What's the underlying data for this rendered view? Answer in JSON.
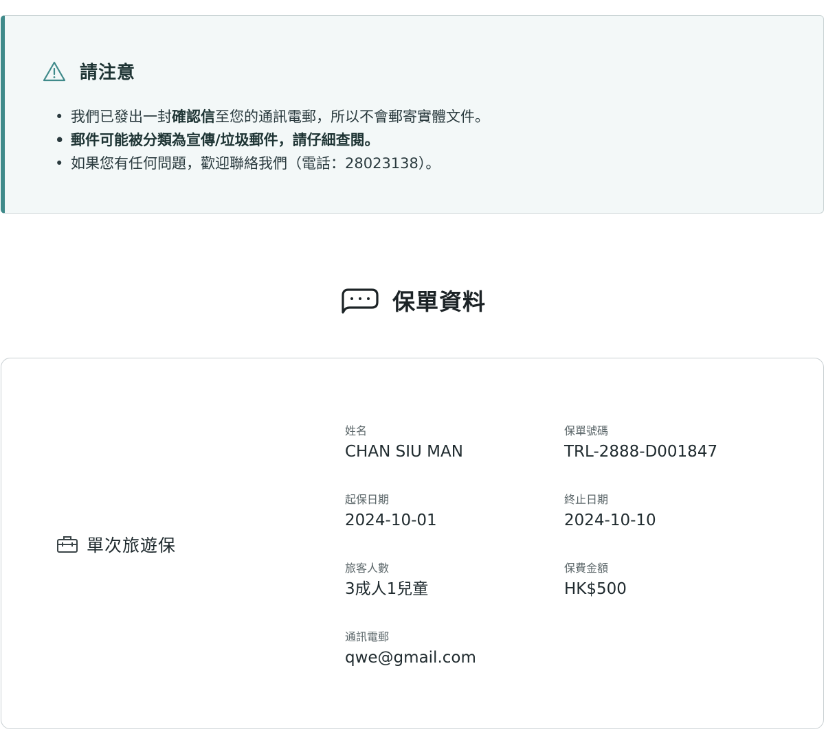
{
  "notice": {
    "title": "請注意",
    "icon": "warning-icon",
    "accent_color": "#3f8a8a",
    "line1_pre": "我們已發出一封",
    "line1_strong": "確認信",
    "line1_post": "至您的通訊電郵，所以不會郵寄實體文件。",
    "line2": "郵件可能被分類為宣傳/垃圾郵件，請仔細查閱。",
    "line3": "如果您有任何問題，歡迎聯絡我們（電話：28023138）。"
  },
  "section": {
    "title": "保單資料",
    "icon": "chat-bubble-icon"
  },
  "policy": {
    "plan_icon": "briefcase-icon",
    "plan_name": "單次旅遊保",
    "fields": {
      "name": {
        "label": "姓名",
        "value": "CHAN SIU MAN"
      },
      "policy_no": {
        "label": "保單號碼",
        "value": "TRL-2888-D001847"
      },
      "start_date": {
        "label": "起保日期",
        "value": "2024-10-01"
      },
      "end_date": {
        "label": "終止日期",
        "value": "2024-10-10"
      },
      "travellers": {
        "label": "旅客人數",
        "value": "3成人1兒童"
      },
      "premium": {
        "label": "保費金額",
        "value": "HK$500"
      },
      "email": {
        "label": "通訊電郵",
        "value": "qwe@gmail.com"
      }
    }
  }
}
